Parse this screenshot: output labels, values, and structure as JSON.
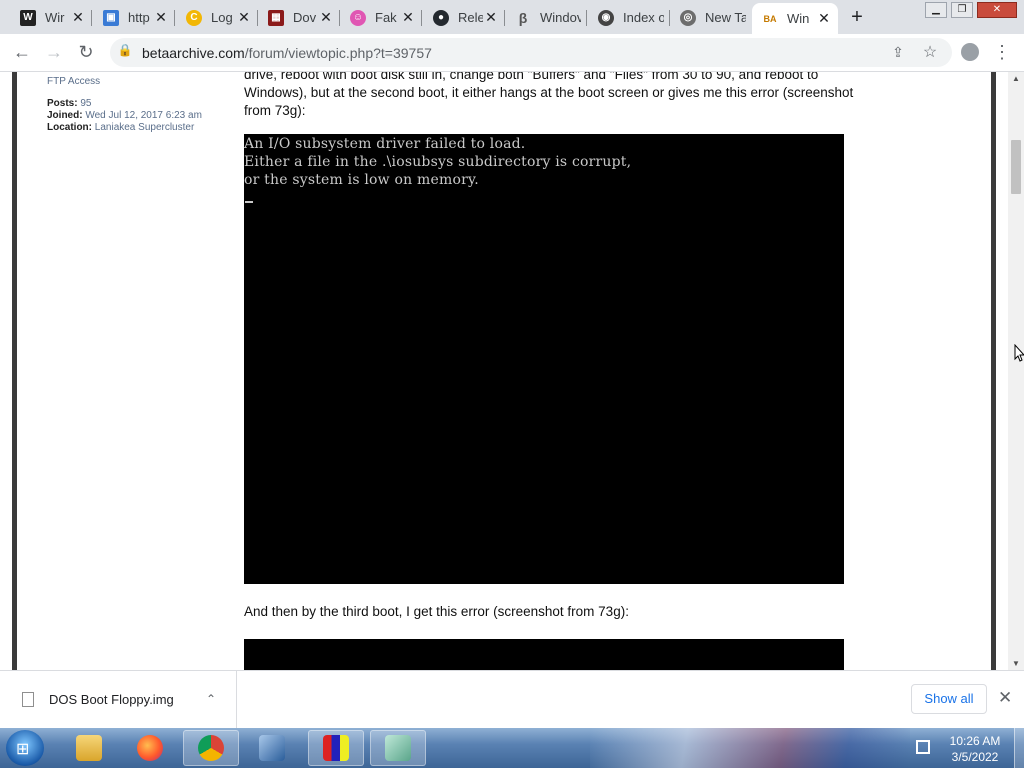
{
  "tabs": [
    {
      "title": "Wir",
      "favicon": "w-icon",
      "color": "#222222",
      "glyph": "W"
    },
    {
      "title": "http",
      "favicon": "image-icon",
      "color": "#3a7bd5",
      "glyph": "▣"
    },
    {
      "title": "Log",
      "favicon": "refresh-icon",
      "color": "#f2b705",
      "glyph": "C"
    },
    {
      "title": "Dov",
      "favicon": "winrar-icon",
      "color": "#8b1a1a",
      "glyph": "▦"
    },
    {
      "title": "Fak",
      "favicon": "face-icon",
      "color": "#e056b3",
      "glyph": "☺"
    },
    {
      "title": "Rele",
      "favicon": "github-icon",
      "color": "#24292f",
      "glyph": "●"
    },
    {
      "title": "Windov",
      "favicon": "beta-icon",
      "color": "#555555",
      "glyph": "β"
    },
    {
      "title": "Index of",
      "favicon": "archive-icon",
      "color": "#444444",
      "glyph": "◉"
    },
    {
      "title": "New Tab",
      "favicon": "chrome-icon",
      "color": "#6d6d6d",
      "glyph": "◎"
    },
    {
      "title": "Win",
      "favicon": "ba-icon",
      "color": "#c57a00",
      "glyph": "BA",
      "active": true
    }
  ],
  "address": {
    "domain": "betaarchive.com",
    "path": "/forum/viewtopic.php?t=39757"
  },
  "profile": {
    "rank": "FTP Access",
    "posts_label": "Posts:",
    "posts_value": "95",
    "joined_label": "Joined:",
    "joined_value": "Wed Jul 12, 2017 6:23 am",
    "location_label": "Location:",
    "location_value": "Laniakea Supercluster"
  },
  "post": {
    "line1": "drive, reboot with boot disk still in, change both \"Buffers\" and \"Files\" from 30 to 90, and reboot to",
    "line2": "Windows), but at the second boot, it either hangs at the boot screen or gives me this error (screenshot",
    "line3": "from 73g):",
    "dos_lines": [
      "An I/O subsystem driver failed to load.",
      "Either a file in the .\\iosubsys subdirectory is corrupt,",
      "or the system is low on memory."
    ],
    "caption2": "And then by the third boot, I get this error (screenshot from 73g):"
  },
  "download": {
    "filename": "DOS Boot Floppy.img",
    "show_all": "Show all"
  },
  "clock": {
    "time": "10:26 AM",
    "date": "3/5/2022"
  }
}
